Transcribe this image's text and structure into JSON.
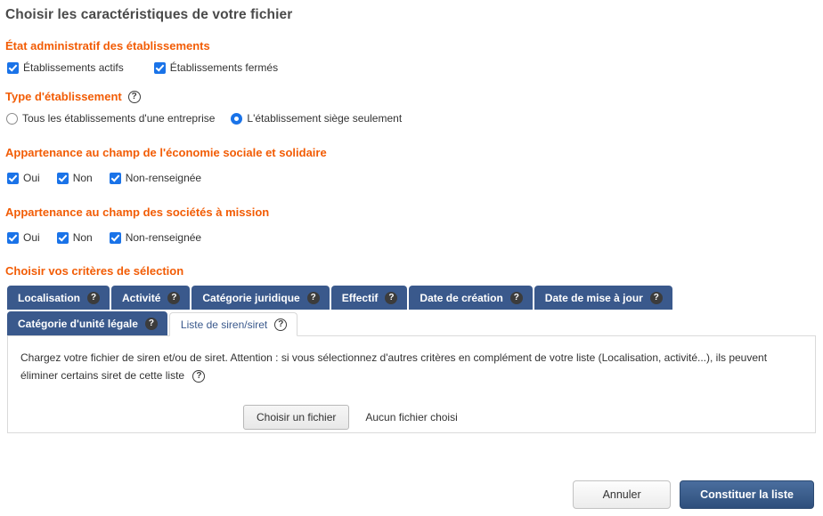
{
  "page_title": "Choisir les caractéristiques de votre fichier",
  "colors": {
    "heading_orange": "#f25c05",
    "tab_blue": "#3a598c",
    "checkbox_blue": "#1a73e8",
    "primary_button": "#2f4f7c",
    "title_gray": "#4a4a4a"
  },
  "sections": {
    "etat_administratif": {
      "heading": "État administratif des établissements",
      "options": [
        {
          "label": "Établissements actifs",
          "checked": true
        },
        {
          "label": "Établissements fermés",
          "checked": true
        }
      ]
    },
    "type_etablissement": {
      "heading": "Type d'établissement",
      "help": "?",
      "options": [
        {
          "label": "Tous les établissements d'une entreprise",
          "selected": false
        },
        {
          "label": "L'établissement siège seulement",
          "selected": true
        }
      ]
    },
    "ess": {
      "heading": "Appartenance au champ de l'économie sociale et solidaire",
      "options": [
        {
          "label": "Oui",
          "checked": true
        },
        {
          "label": "Non",
          "checked": true
        },
        {
          "label": "Non-renseignée",
          "checked": true
        }
      ]
    },
    "societes_mission": {
      "heading": "Appartenance au champ des sociétés à mission",
      "options": [
        {
          "label": "Oui",
          "checked": true
        },
        {
          "label": "Non",
          "checked": true
        },
        {
          "label": "Non-renseignée",
          "checked": true
        }
      ]
    },
    "criteres": {
      "heading": "Choisir vos critères de sélection",
      "tabs_row1": [
        {
          "label": "Localisation",
          "help": "?",
          "active": false
        },
        {
          "label": "Activité",
          "help": "?",
          "active": false
        },
        {
          "label": "Catégorie juridique",
          "help": "?",
          "active": false
        },
        {
          "label": "Effectif",
          "help": "?",
          "active": false
        },
        {
          "label": "Date de création",
          "help": "?",
          "active": false
        },
        {
          "label": "Date de mise à jour",
          "help": "?",
          "active": false
        }
      ],
      "tabs_row2": [
        {
          "label": "Catégorie d'unité légale",
          "help": "?",
          "active": false
        },
        {
          "label": "Liste de siren/siret",
          "help": "?",
          "active": true
        }
      ],
      "panel": {
        "description": "Chargez votre fichier de siren et/ou de siret. Attention : si vous sélectionnez d'autres critères en complément de votre liste (Localisation, activité...), ils peuvent éliminer certains siret de cette liste",
        "help": "?",
        "file_button_label": "Choisir un fichier",
        "file_status": "Aucun fichier choisi"
      }
    }
  },
  "footer": {
    "cancel_label": "Annuler",
    "submit_label": "Constituer la liste"
  },
  "help_glyph": "?"
}
